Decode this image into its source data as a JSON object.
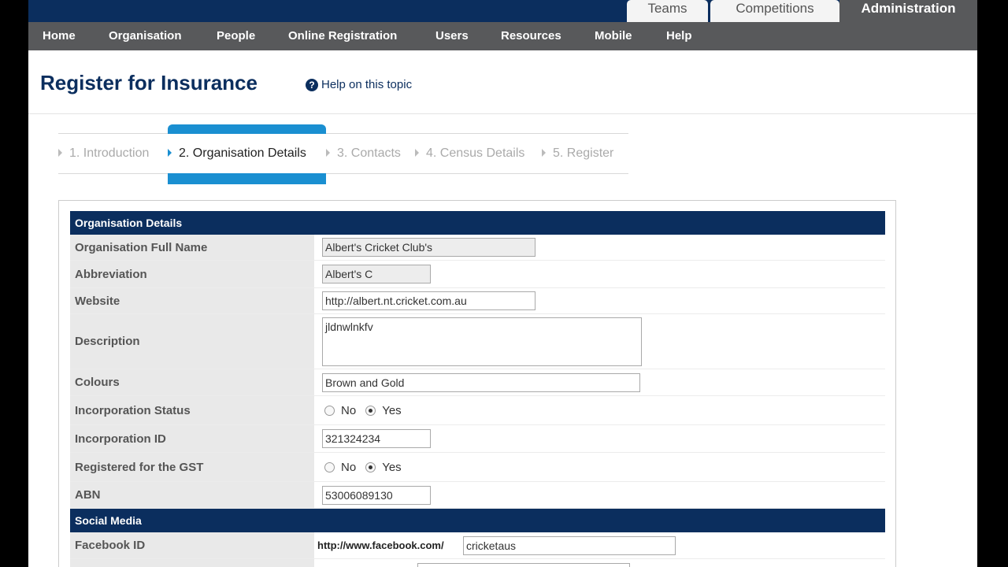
{
  "top_tabs": {
    "teams": "Teams",
    "competitions": "Competitions",
    "administration": "Administration"
  },
  "nav": [
    "Home",
    "Organisation",
    "People",
    "Online Registration",
    "Users",
    "Resources",
    "Mobile",
    "Help"
  ],
  "header": {
    "title": "Register for Insurance",
    "help_icon": "?",
    "help_link": "Help on this topic"
  },
  "wizard": {
    "steps": [
      "1. Introduction",
      "2. Organisation Details",
      "3. Contacts",
      "4. Census Details",
      "5. Register"
    ],
    "active_index": 1
  },
  "sections": {
    "organisation_details": "Organisation Details",
    "social_media": "Social Media"
  },
  "fields": {
    "full_name": {
      "label": "Organisation Full Name",
      "value": "Albert's Cricket Club's"
    },
    "abbreviation": {
      "label": "Abbreviation",
      "value": "Albert's C"
    },
    "website": {
      "label": "Website",
      "value": "http://albert.nt.cricket.com.au"
    },
    "description": {
      "label": "Description",
      "value": "jldnwlnkfv"
    },
    "colours": {
      "label": "Colours",
      "value": "Brown and Gold"
    },
    "incorporation_status": {
      "label": "Incorporation Status",
      "options": [
        "No",
        "Yes"
      ],
      "selected": "Yes"
    },
    "incorporation_id": {
      "label": "Incorporation ID",
      "value": "321324234"
    },
    "gst": {
      "label": "Registered for the GST",
      "options": [
        "No",
        "Yes"
      ],
      "selected": "Yes"
    },
    "abn": {
      "label": "ABN",
      "value": "53006089130"
    },
    "facebook": {
      "label": "Facebook ID",
      "prefix": "http://www.facebook.com/",
      "value": "cricketaus"
    }
  },
  "colors": {
    "navy": "#0b2e5e",
    "nav_gray": "#58595b",
    "step_blue": "#1a8fd1"
  }
}
